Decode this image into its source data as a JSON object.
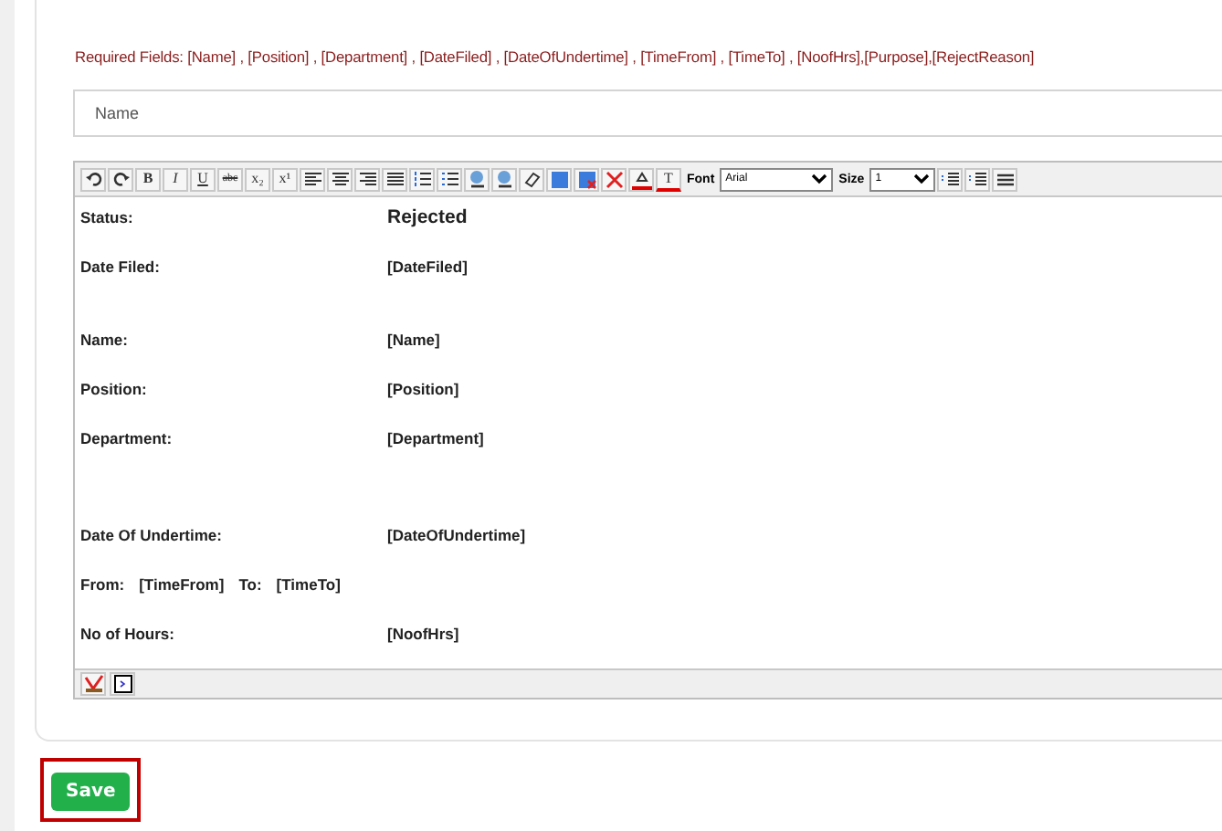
{
  "required_fields": "Required Fields: [Name] , [Position] , [Department] , [DateFiled] , [DateOfUndertime] , [TimeFrom] , [TimeTo] , [NoofHrs],[Purpose],[RejectReason]",
  "name_field": {
    "placeholder": "Name"
  },
  "editor": {
    "toolbar": {
      "glyphs": [
        "B",
        "I",
        "U",
        "abc",
        "x₂",
        "x¹",
        "T"
      ],
      "font_label": "Font",
      "font_value": "Arial",
      "size_label": "Size",
      "size_value": "1"
    },
    "content": [
      {
        "kind": "status",
        "label": "Status:",
        "value": "Rejected"
      },
      {
        "kind": "field",
        "label": "Date Filed:",
        "value": "[DateFiled]"
      },
      {
        "kind": "blank"
      },
      {
        "kind": "field",
        "label": "Name:",
        "value": "[Name]"
      },
      {
        "kind": "field",
        "label": "Position:",
        "value": "[Position]"
      },
      {
        "kind": "field",
        "label": "Department:",
        "value": "[Department]"
      },
      {
        "kind": "blank"
      },
      {
        "kind": "blank"
      },
      {
        "kind": "field",
        "label": "Date Of Undertime:",
        "value": "[DateOfUndertime]"
      },
      {
        "kind": "inline",
        "label": "From:",
        "value": "[TimeFrom]",
        "label_2": "To:",
        "value_2": "[TimeTo]"
      },
      {
        "kind": "field",
        "label": "No of Hours:",
        "value": "[NoofHrs]"
      }
    ]
  },
  "save_button": "Save"
}
